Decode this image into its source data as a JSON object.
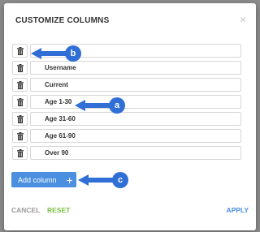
{
  "dialog": {
    "title": "CUSTOMIZE COLUMNS",
    "close_symbol": "×"
  },
  "rows": [
    {
      "label": ""
    },
    {
      "label": "Username"
    },
    {
      "label": "Current"
    },
    {
      "label": "Age 1-30"
    },
    {
      "label": "Age 31-60"
    },
    {
      "label": "Age 61-90"
    },
    {
      "label": "Over 90"
    }
  ],
  "add_button": {
    "label": "Add column",
    "icon": "plus-icon",
    "symbol": "+"
  },
  "footer": {
    "cancel": "CANCEL",
    "reset": "RESET",
    "apply": "APPLY"
  },
  "callouts": [
    {
      "letter": "b",
      "target": "first row delete button"
    },
    {
      "letter": "a",
      "target": "Age 1-30 field"
    },
    {
      "letter": "c",
      "target": "Add column button"
    }
  ],
  "colors": {
    "accent": "#4a8fe0",
    "reset": "#7ac142",
    "callout": "#2f6fd6"
  }
}
